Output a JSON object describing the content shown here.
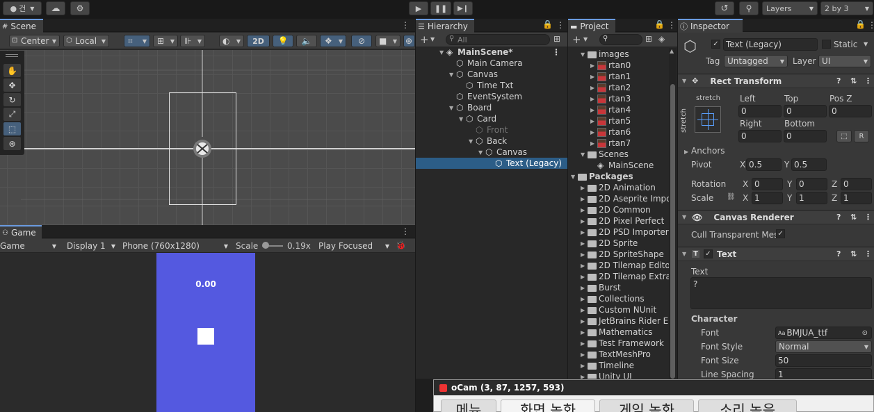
{
  "toolbar": {
    "account": "건",
    "layers": "Layers",
    "layout": "2 by 3"
  },
  "scene": {
    "tab": "Scene",
    "pivot_mode": "Center",
    "space_mode": "Local",
    "mode_2d": "2D",
    "tools": [
      "hand-tool-icon",
      "move-tool-icon",
      "rotate-tool-icon",
      "scale-tool-icon",
      "rect-tool-icon",
      "transform-tool-icon"
    ]
  },
  "game": {
    "tab": "Game",
    "view": "Game",
    "display": "Display 1",
    "resolution": "Phone (760x1280)",
    "scale_label": "Scale",
    "scale_value": "0.19x",
    "focus": "Play Focused",
    "timer": "0.00"
  },
  "hierarchy": {
    "tab": "Hierarchy",
    "search_placeholder": "All",
    "items": [
      {
        "label": "MainScene*",
        "depth": 0,
        "fold": "open",
        "kind": "scene",
        "bold": true,
        "inactive": false,
        "selected": false
      },
      {
        "label": "Main Camera",
        "depth": 1,
        "fold": "none",
        "kind": "go",
        "bold": false,
        "inactive": false,
        "selected": false
      },
      {
        "label": "Canvas",
        "depth": 1,
        "fold": "open",
        "kind": "go",
        "bold": false,
        "inactive": false,
        "selected": false
      },
      {
        "label": "Time Txt",
        "depth": 2,
        "fold": "none",
        "kind": "go",
        "bold": false,
        "inactive": false,
        "selected": false
      },
      {
        "label": "EventSystem",
        "depth": 1,
        "fold": "none",
        "kind": "go",
        "bold": false,
        "inactive": false,
        "selected": false
      },
      {
        "label": "Board",
        "depth": 1,
        "fold": "open",
        "kind": "go",
        "bold": false,
        "inactive": false,
        "selected": false
      },
      {
        "label": "Card",
        "depth": 2,
        "fold": "open",
        "kind": "go",
        "bold": false,
        "inactive": false,
        "selected": false
      },
      {
        "label": "Front",
        "depth": 3,
        "fold": "none",
        "kind": "go",
        "bold": false,
        "inactive": true,
        "selected": false
      },
      {
        "label": "Back",
        "depth": 3,
        "fold": "open",
        "kind": "go",
        "bold": false,
        "inactive": false,
        "selected": false
      },
      {
        "label": "Canvas",
        "depth": 4,
        "fold": "open",
        "kind": "go",
        "bold": false,
        "inactive": false,
        "selected": false
      },
      {
        "label": "Text (Legacy)",
        "depth": 5,
        "fold": "none",
        "kind": "go",
        "bold": false,
        "inactive": false,
        "selected": true
      }
    ]
  },
  "project": {
    "tab": "Project",
    "items": [
      {
        "label": "images",
        "depth": 0,
        "fold": "open",
        "kind": "folder"
      },
      {
        "label": "rtan0",
        "depth": 1,
        "fold": "closed",
        "kind": "sprite"
      },
      {
        "label": "rtan1",
        "depth": 1,
        "fold": "closed",
        "kind": "sprite"
      },
      {
        "label": "rtan2",
        "depth": 1,
        "fold": "closed",
        "kind": "sprite"
      },
      {
        "label": "rtan3",
        "depth": 1,
        "fold": "closed",
        "kind": "sprite"
      },
      {
        "label": "rtan4",
        "depth": 1,
        "fold": "closed",
        "kind": "sprite"
      },
      {
        "label": "rtan5",
        "depth": 1,
        "fold": "closed",
        "kind": "sprite"
      },
      {
        "label": "rtan6",
        "depth": 1,
        "fold": "closed",
        "kind": "sprite"
      },
      {
        "label": "rtan7",
        "depth": 1,
        "fold": "closed",
        "kind": "sprite"
      },
      {
        "label": "Scenes",
        "depth": 0,
        "fold": "open",
        "kind": "folder"
      },
      {
        "label": "MainScene",
        "depth": 1,
        "fold": "none",
        "kind": "scene"
      },
      {
        "label": "Packages",
        "depth": -1,
        "fold": "open",
        "kind": "folder"
      },
      {
        "label": "2D Animation",
        "depth": 0,
        "fold": "closed",
        "kind": "folder"
      },
      {
        "label": "2D Aseprite Impo",
        "depth": 0,
        "fold": "closed",
        "kind": "folder"
      },
      {
        "label": "2D Common",
        "depth": 0,
        "fold": "closed",
        "kind": "folder"
      },
      {
        "label": "2D Pixel Perfect",
        "depth": 0,
        "fold": "closed",
        "kind": "folder"
      },
      {
        "label": "2D PSD Importer",
        "depth": 0,
        "fold": "closed",
        "kind": "folder"
      },
      {
        "label": "2D Sprite",
        "depth": 0,
        "fold": "closed",
        "kind": "folder"
      },
      {
        "label": "2D SpriteShape",
        "depth": 0,
        "fold": "closed",
        "kind": "folder"
      },
      {
        "label": "2D Tilemap Edito",
        "depth": 0,
        "fold": "closed",
        "kind": "folder"
      },
      {
        "label": "2D Tilemap Extra",
        "depth": 0,
        "fold": "closed",
        "kind": "folder"
      },
      {
        "label": "Burst",
        "depth": 0,
        "fold": "closed",
        "kind": "folder"
      },
      {
        "label": "Collections",
        "depth": 0,
        "fold": "closed",
        "kind": "folder"
      },
      {
        "label": "Custom NUnit",
        "depth": 0,
        "fold": "closed",
        "kind": "folder"
      },
      {
        "label": "JetBrains Rider E",
        "depth": 0,
        "fold": "closed",
        "kind": "folder"
      },
      {
        "label": "Mathematics",
        "depth": 0,
        "fold": "closed",
        "kind": "folder"
      },
      {
        "label": "Test Framework",
        "depth": 0,
        "fold": "closed",
        "kind": "folder"
      },
      {
        "label": "TextMeshPro",
        "depth": 0,
        "fold": "closed",
        "kind": "folder"
      },
      {
        "label": "Timeline",
        "depth": 0,
        "fold": "closed",
        "kind": "folder"
      },
      {
        "label": "Unity UI",
        "depth": 0,
        "fold": "closed",
        "kind": "folder"
      }
    ]
  },
  "inspector": {
    "tab": "Inspector",
    "name": "Text (Legacy)",
    "static_label": "Static",
    "tag_label": "Tag",
    "tag": "Untagged",
    "layer_label": "Layer",
    "layer": "UI",
    "rect": {
      "title": "Rect Transform",
      "anchor_h": "stretch",
      "anchor_v": "stretch",
      "left_label": "Left",
      "left": "0",
      "top_label": "Top",
      "top": "0",
      "posz_label": "Pos Z",
      "posz": "0",
      "right_label": "Right",
      "right": "0",
      "bottom_label": "Bottom",
      "bottom": "0",
      "r_button": "R",
      "anchors_label": "Anchors",
      "pivot_label": "Pivot",
      "pivot_x": "0.5",
      "pivot_y": "0.5",
      "rotation_label": "Rotation",
      "rot_x": "0",
      "rot_y": "0",
      "rot_z": "0",
      "scale_label": "Scale",
      "scale_x": "1",
      "scale_y": "1",
      "scale_z": "1",
      "x": "X",
      "y": "Y",
      "z": "Z"
    },
    "canvas_renderer": {
      "title": "Canvas Renderer",
      "cull_label": "Cull Transparent Mes"
    },
    "text": {
      "title": "Text",
      "text_label": "Text",
      "text_value": "?",
      "character_label": "Character",
      "font_label": "Font",
      "font": "BMJUA_ttf",
      "font_icon": "Aa",
      "style_label": "Font Style",
      "style": "Normal",
      "size_label": "Font Size",
      "size": "50",
      "spacing_label": "Line Spacing",
      "spacing": "1"
    }
  },
  "ocam": {
    "title": "oCam (3, 87, 1257, 593)",
    "tabs": [
      "메뉴",
      "화면 녹화",
      "게임 녹화",
      "소리 녹음"
    ]
  }
}
